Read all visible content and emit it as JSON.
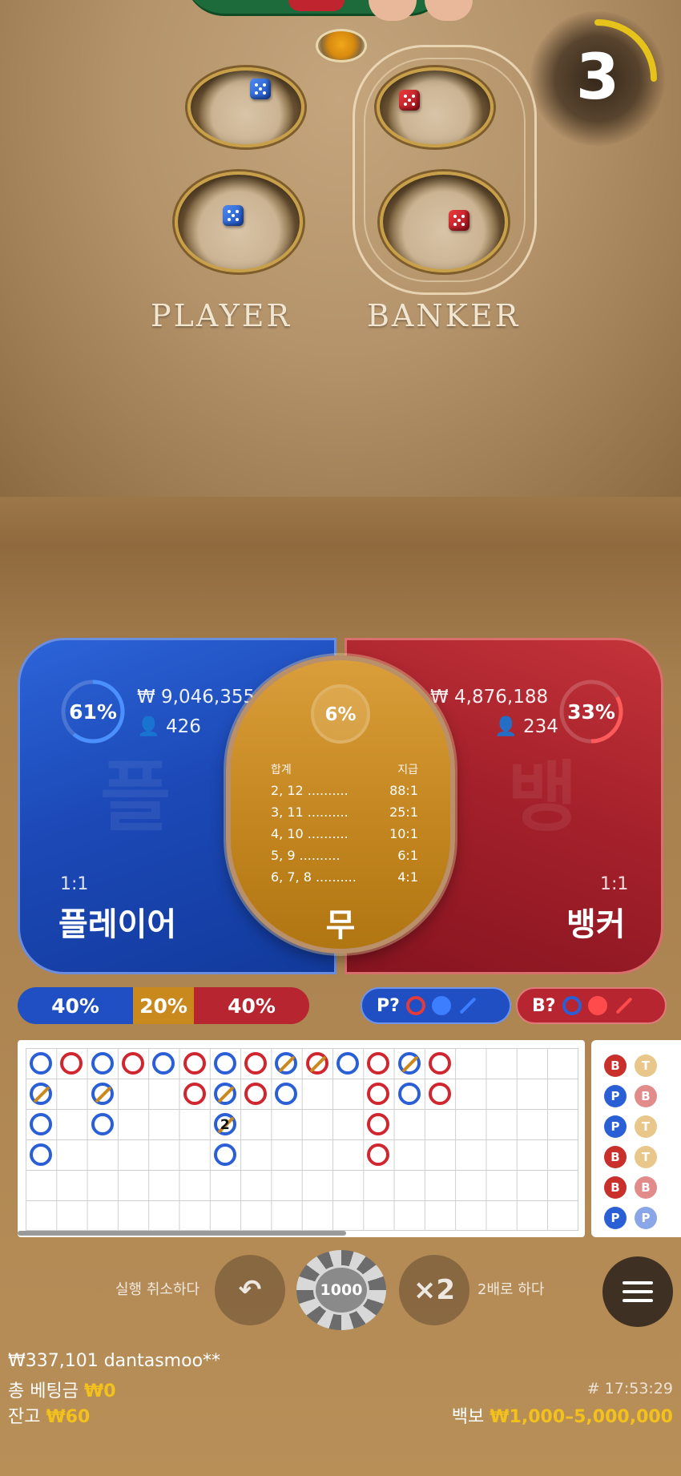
{
  "table": {
    "player_label": "PLAYER",
    "banker_label": "BANKER"
  },
  "timer": {
    "value": "3",
    "remaining_fraction": 0.25
  },
  "bets": {
    "player": {
      "percent": "61%",
      "percent_value": 0.61,
      "amount": "₩ 9,046,355",
      "players": "426",
      "odds": "1:1",
      "name": "플레이어",
      "ghost": "플"
    },
    "banker": {
      "percent": "33%",
      "percent_value": 0.33,
      "amount": "₩ 4,876,188",
      "players": "234",
      "odds": "1:1",
      "name": "뱅커",
      "ghost": "뱅"
    },
    "tie": {
      "percent": "6%",
      "name": "무",
      "head_left": "합계",
      "head_right": "지급",
      "payouts": [
        {
          "sum": "2, 12",
          "pay": "88:1"
        },
        {
          "sum": "3, 11",
          "pay": "25:1"
        },
        {
          "sum": "4, 10",
          "pay": "10:1"
        },
        {
          "sum": "5, 9",
          "pay": "6:1"
        },
        {
          "sum": "6, 7, 8",
          "pay": "4:1"
        }
      ]
    }
  },
  "bias": {
    "player": "40%",
    "tie": "20%",
    "banker": "40%"
  },
  "predict": {
    "player_label": "P?",
    "banker_label": "B?"
  },
  "colors": {
    "player": "#2b5fd6",
    "banker": "#d0262f",
    "tie": "#c9891c",
    "gold": "#f3c11b"
  },
  "big_road": [
    [
      {
        "c": "P"
      },
      {
        "c": "P",
        "t": true
      },
      {
        "c": "P"
      },
      {
        "c": "P"
      }
    ],
    [
      {
        "c": "B"
      }
    ],
    [
      {
        "c": "P"
      },
      {
        "c": "P",
        "t": true
      },
      {
        "c": "P"
      }
    ],
    [
      {
        "c": "B"
      }
    ],
    [
      {
        "c": "P"
      }
    ],
    [
      {
        "c": "B"
      },
      {
        "c": "B"
      }
    ],
    [
      {
        "c": "P"
      },
      {
        "c": "P",
        "t": true
      },
      {
        "c": "P",
        "t": true,
        "n": "2"
      },
      {
        "c": "P"
      }
    ],
    [
      {
        "c": "B"
      },
      {
        "c": "B"
      }
    ],
    [
      {
        "c": "P",
        "t": true
      },
      {
        "c": "P"
      }
    ],
    [
      {
        "c": "B",
        "t": true
      }
    ],
    [
      {
        "c": "P"
      }
    ],
    [
      {
        "c": "B"
      },
      {
        "c": "B"
      },
      {
        "c": "B"
      },
      {
        "c": "B"
      }
    ],
    [
      {
        "c": "P",
        "t": true
      },
      {
        "c": "P"
      }
    ],
    [
      {
        "c": "B"
      },
      {
        "c": "B"
      }
    ]
  ],
  "bead_road": [
    [
      "B",
      "P",
      "P",
      "B",
      "B",
      "P"
    ],
    [
      "T",
      "B",
      "T",
      "T",
      "B",
      "P"
    ]
  ],
  "controls": {
    "undo_label": "실행 취소하다",
    "chip_value": "1000",
    "double_symbol": "×2",
    "double_label": "2배로 하다"
  },
  "footer": {
    "user_line": "₩337,101 dantasmoo**",
    "total_bet_label": "총 베팅금",
    "total_bet_value": "₩0",
    "balance_label": "잔고",
    "balance_value": "₩60",
    "round_time": "# 17:53:29",
    "limit_label": "백보",
    "limit_value": "₩1,000–5,000,000"
  }
}
